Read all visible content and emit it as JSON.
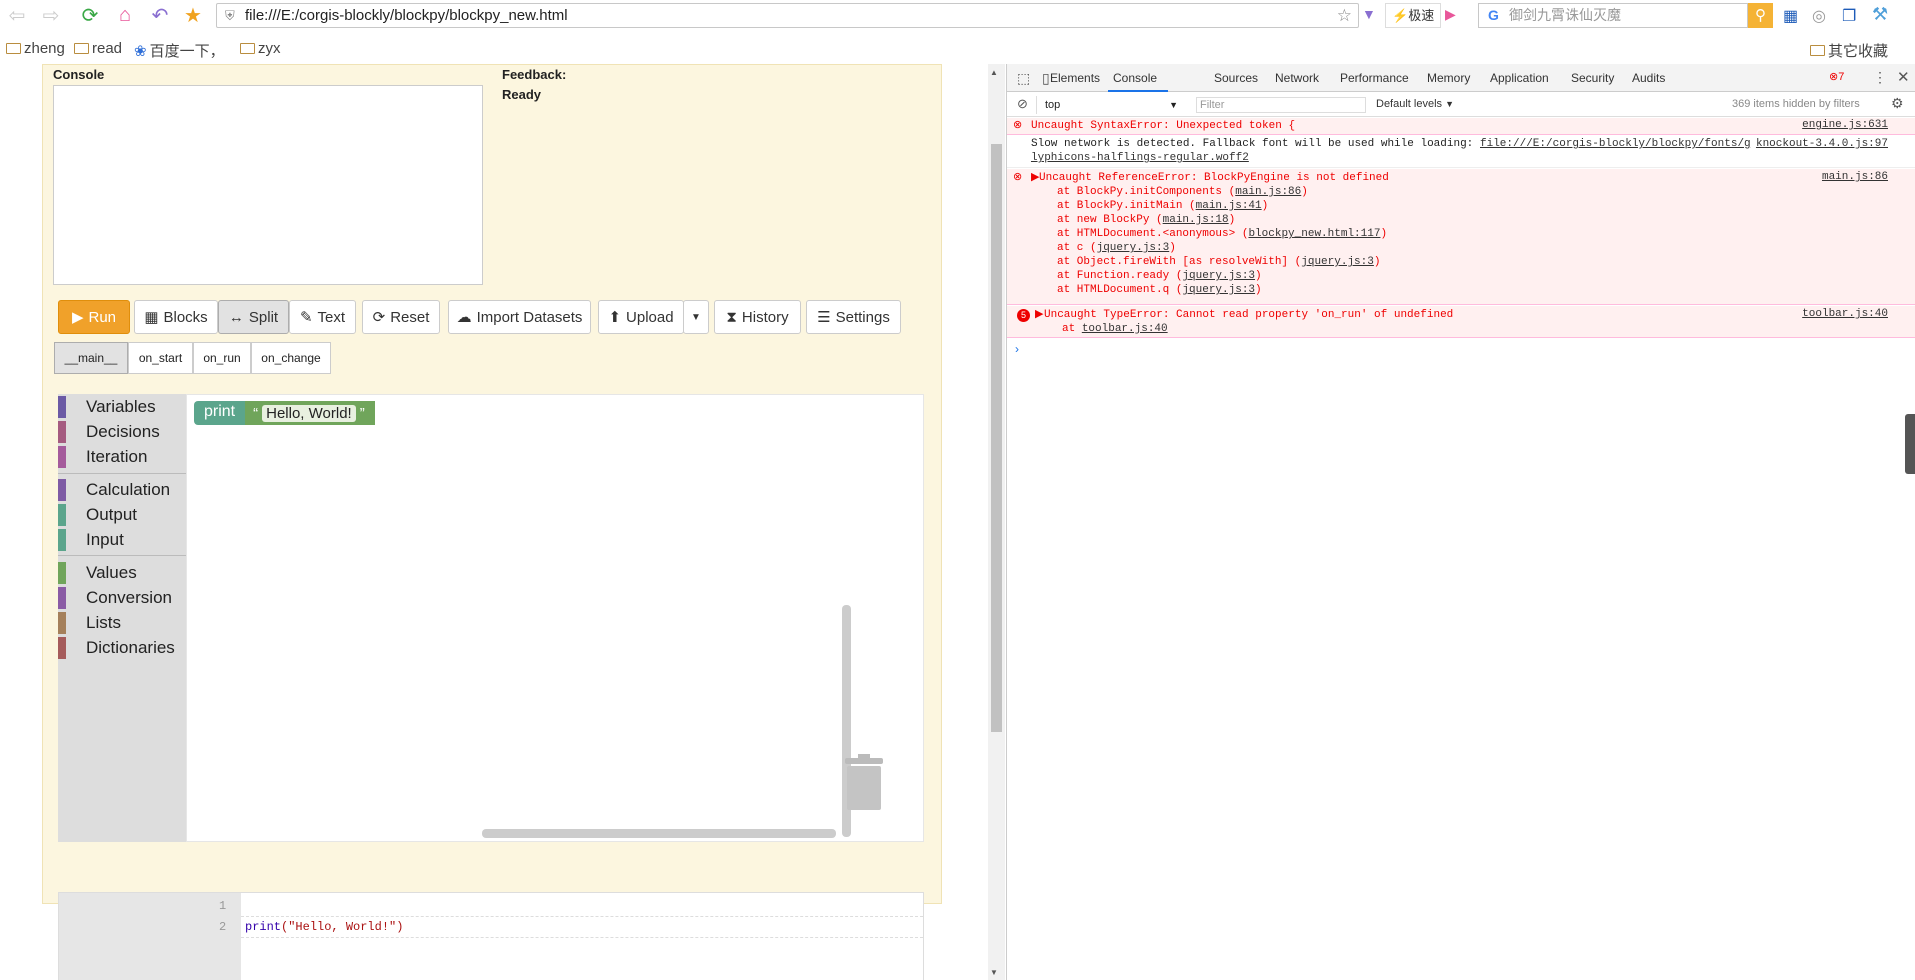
{
  "browser": {
    "url": "file:///E:/corgis-blockly/blockpy/blockpy_new.html",
    "speed_label": "极速",
    "search_placeholder": "御剑九霄诛仙灭魔",
    "bookmarks": [
      "zheng",
      "read",
      "百度一下，",
      "zyx"
    ],
    "other_bookmarks": "其它收藏"
  },
  "page": {
    "console_label": "Console",
    "feedback_label": "Feedback:",
    "feedback_status": "Ready",
    "toolbar": {
      "run": "Run",
      "blocks": "Blocks",
      "split": "Split",
      "text": "Text",
      "reset": "Reset",
      "import": "Import Datasets",
      "upload": "Upload",
      "history": "History",
      "settings": "Settings"
    },
    "tabs": [
      "__main__",
      "on_start",
      "on_run",
      "on_change"
    ],
    "categories": [
      {
        "label": "Variables",
        "color": "#6b5aa5"
      },
      {
        "label": "Decisions",
        "color": "#a55b80"
      },
      {
        "label": "Iteration",
        "color": "#a55b9c"
      },
      {
        "label": "Calculation",
        "color": "#7e5ba5"
      },
      {
        "label": "Output",
        "color": "#5ba58c"
      },
      {
        "label": "Input",
        "color": "#5ba58c"
      },
      {
        "label": "Values",
        "color": "#70a55b"
      },
      {
        "label": "Conversion",
        "color": "#8a5ba5"
      },
      {
        "label": "Lists",
        "color": "#a5805b"
      },
      {
        "label": "Dictionaries",
        "color": "#a55b5b"
      }
    ],
    "block": {
      "print": "print",
      "string": "Hello, World!",
      "open_quote": "“",
      "close_quote": "”"
    },
    "code": {
      "line1": "1",
      "line2": "2",
      "code_keyword": "print",
      "code_arg": "(\"Hello, World!\")"
    }
  },
  "devtools": {
    "tabs": [
      "Elements",
      "Console",
      "Sources",
      "Network",
      "Performance",
      "Memory",
      "Application",
      "Security",
      "Audits"
    ],
    "error_count": "7",
    "context": "top",
    "filter_placeholder": "Filter",
    "levels": "Default levels",
    "hidden": "369 items hidden by filters",
    "messages": {
      "m1": "Uncaught SyntaxError: Unexpected token {",
      "m1_src": "engine.js:631",
      "m2a": "Slow network is detected. Fallback font will be used while loading: ",
      "m2_link": "file:///E:/corgis-blockly/blockpy/fonts/g",
      "m2_src": "knockout-3.4.0.js:97",
      "m2b": "lyphicons-halflings-regular.woff2",
      "m3": "Uncaught ReferenceError: BlockPyEngine is not defined",
      "m3_src": "main.js:86",
      "stack": [
        [
          "at BlockPy.initComponents (",
          "main.js:86",
          ")"
        ],
        [
          "at BlockPy.initMain (",
          "main.js:41",
          ")"
        ],
        [
          "at new BlockPy (",
          "main.js:18",
          ")"
        ],
        [
          "at HTMLDocument.<anonymous> (",
          "blockpy_new.html:117",
          ")"
        ],
        [
          "at c (",
          "jquery.js:3",
          ")"
        ],
        [
          "at Object.fireWith [as resolveWith] (",
          "jquery.js:3",
          ")"
        ],
        [
          "at Function.ready (",
          "jquery.js:3",
          ")"
        ],
        [
          "at HTMLDocument.q (",
          "jquery.js:3",
          ")"
        ]
      ],
      "m4_count": "5",
      "m4": "Uncaught TypeError: Cannot read property 'on_run' of undefined",
      "m4_src": "toolbar.js:40",
      "m4_at": "at ",
      "m4_at_link": "toolbar.js:40"
    }
  }
}
